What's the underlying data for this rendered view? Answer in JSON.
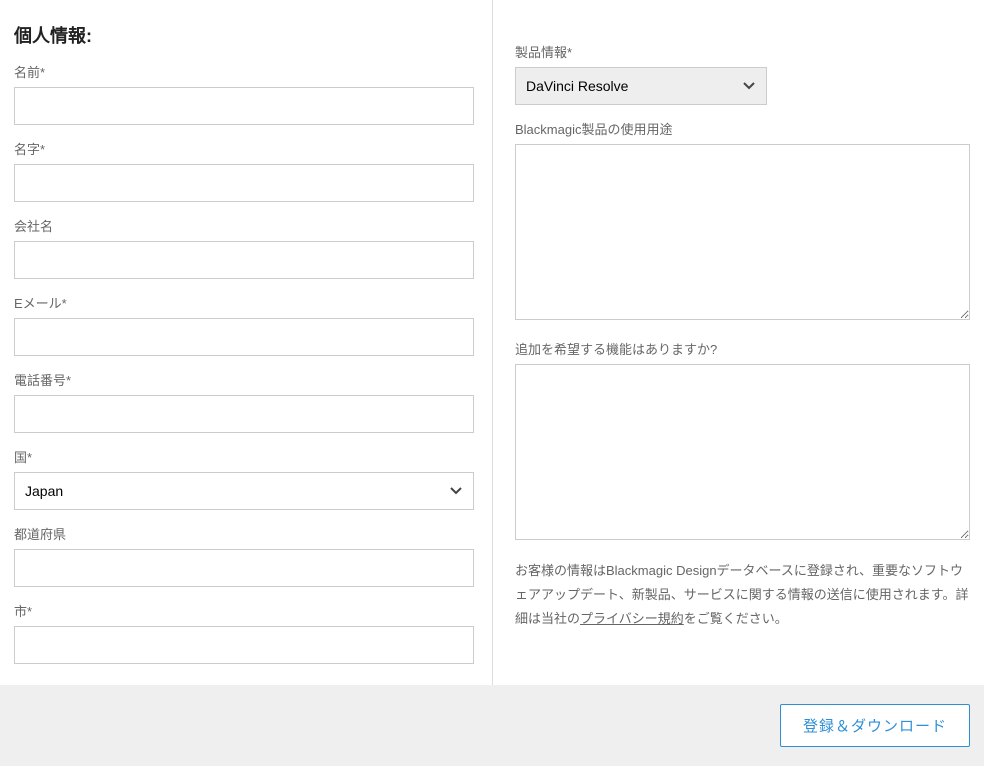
{
  "left": {
    "section_title": "個人情報:",
    "first_name_label": "名前*",
    "first_name_value": "",
    "last_name_label": "名字*",
    "last_name_value": "",
    "company_label": "会社名",
    "company_value": "",
    "email_label": "Eメール*",
    "email_value": "",
    "phone_label": "電話番号*",
    "phone_value": "",
    "country_label": "国*",
    "country_value": "Japan",
    "state_label": "都道府県",
    "state_value": "",
    "city_label": "市*",
    "city_value": ""
  },
  "right": {
    "product_label": "製品情報*",
    "product_value": "DaVinci Resolve",
    "usage_label": "Blackmagic製品の使用用途",
    "usage_value": "",
    "features_label": "追加を希望する機能はありますか?",
    "features_value": "",
    "privacy_text_1": "お客様の情報はBlackmagic Designデータベースに登録され、重要なソフトウェアアップデート、新製品、サービスに関する情報の送信に使用されます。詳細は当社の",
    "privacy_link": "プライバシー規約",
    "privacy_text_2": "をご覧ください。"
  },
  "footer": {
    "submit_label": "登録＆ダウンロード"
  }
}
